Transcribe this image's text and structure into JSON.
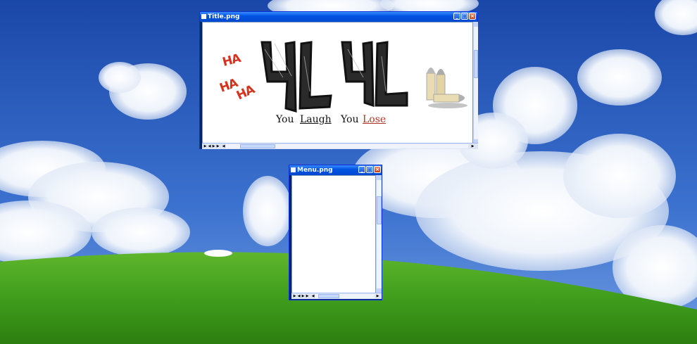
{
  "desktop": {
    "wallpaper": "bliss-hills",
    "sky_color": "#2a5dbd",
    "grass_color": "#3f9d1c"
  },
  "windows": [
    {
      "title": "Title.png",
      "buttons": [
        "minimize",
        "maximize",
        "close"
      ],
      "image": {
        "laughs": [
          "HA",
          "HA",
          "HA"
        ],
        "logo_text": "YLYL",
        "tagline": [
          "You",
          "Laugh",
          "You",
          "Lose"
        ]
      }
    },
    {
      "title": "Menu.png",
      "buttons": [
        "minimize",
        "maximize",
        "close"
      ]
    }
  ]
}
